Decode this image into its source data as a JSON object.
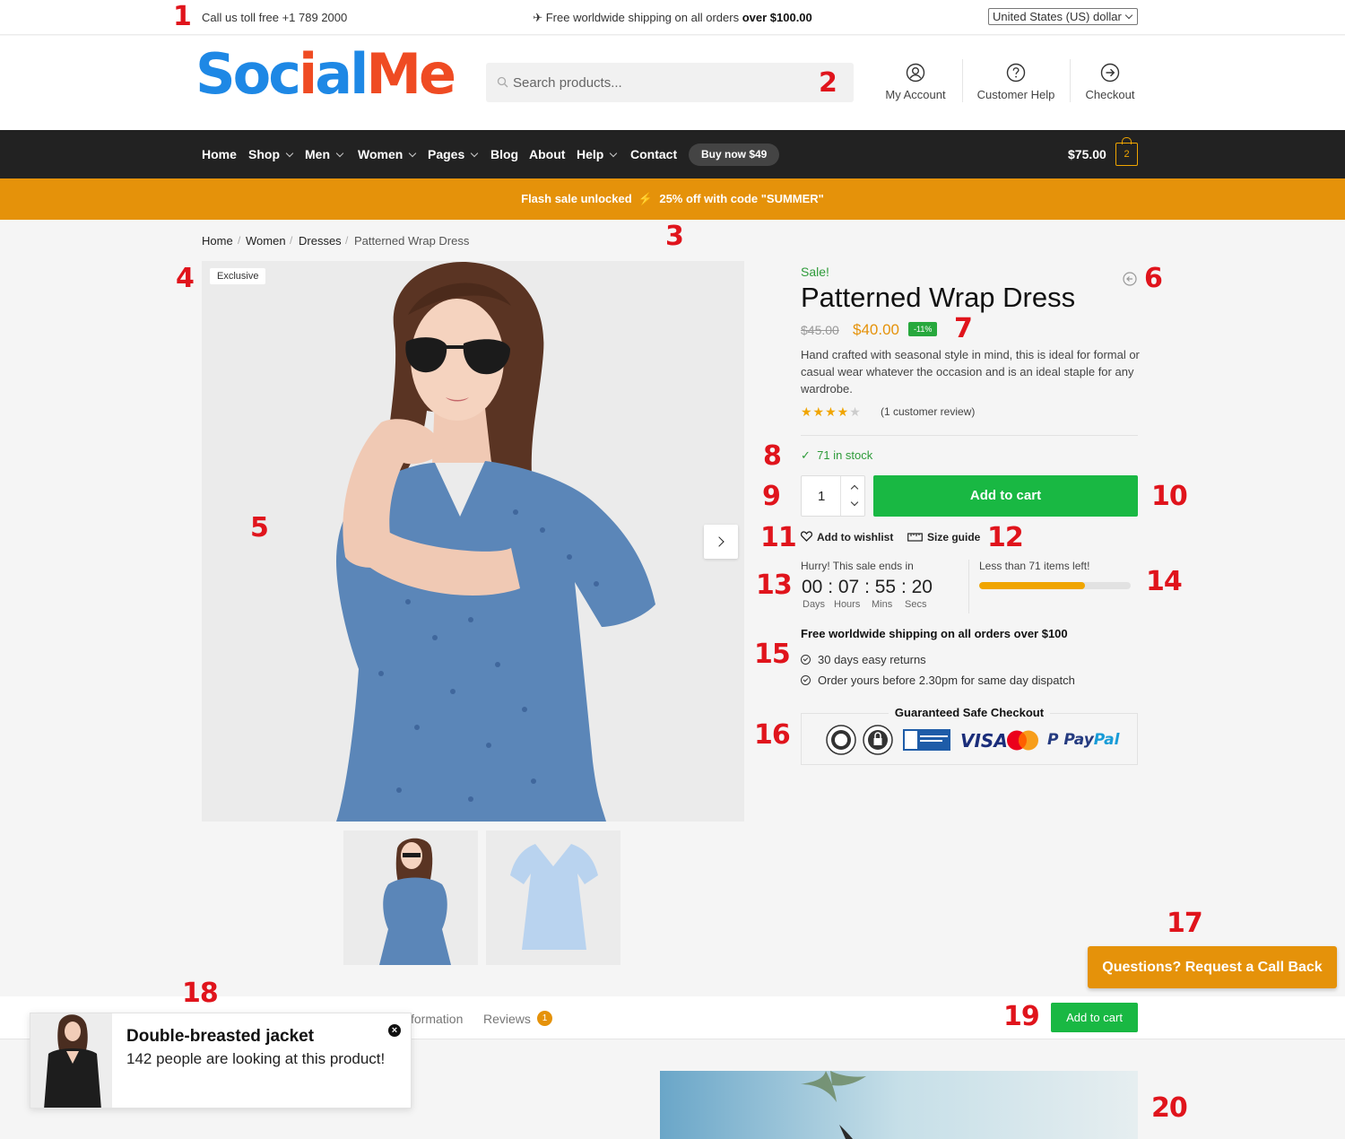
{
  "annotations": [
    "1",
    "2",
    "3",
    "4",
    "5",
    "6",
    "7",
    "8",
    "9",
    "10",
    "11",
    "12",
    "13",
    "14",
    "15",
    "16",
    "17",
    "18",
    "19",
    "20"
  ],
  "topbar": {
    "call": "Call us toll free +1 789 2000",
    "shipping_prefix": "Free worldwide shipping on all orders",
    "shipping_bold": "over $100.00",
    "currency": "United States (US) dollar"
  },
  "header": {
    "logo_part1": "Soc",
    "logo_part2": "i",
    "logo_part3": "al",
    "logo_part4": "Me",
    "search_placeholder": "Search products...",
    "links": {
      "account": "My Account",
      "help": "Customer Help",
      "checkout": "Checkout"
    }
  },
  "nav": {
    "items": [
      "Home",
      "Shop",
      "Men",
      "Women",
      "Pages",
      "Blog",
      "About",
      "Help",
      "Contact"
    ],
    "buy_now": "Buy now $49",
    "cart_total": "$75.00",
    "cart_count": "2"
  },
  "flash": {
    "text": "Flash sale unlocked",
    "code_text": "25% off with code \"SUMMER\""
  },
  "breadcrumb": [
    "Home",
    "Women",
    "Dresses",
    "Patterned Wrap Dress"
  ],
  "gallery": {
    "badge": "Exclusive"
  },
  "product": {
    "sale": "Sale!",
    "title": "Patterned Wrap Dress",
    "old_price": "$45.00",
    "price": "$40.00",
    "discount": "-11%",
    "description": "Hand crafted with seasonal style in mind, this is ideal for formal or casual wear whatever the occasion and is an ideal staple for any wardrobe.",
    "rating": 4,
    "reviews": "(1 customer review)",
    "stock": "71 in stock",
    "quantity": "1",
    "add_to_cart": "Add to cart",
    "wishlist": "Add to wishlist",
    "size_guide": "Size guide",
    "hurry": "Hurry! This sale ends in",
    "timer": {
      "days": "00",
      "hours": "07",
      "mins": "55",
      "secs": "20"
    },
    "timer_labels": {
      "days": "Days",
      "hours": "Hours",
      "mins": "Mins",
      "secs": "Secs"
    },
    "less_than": "Less than 71 items left!",
    "stock_progress": 0.7,
    "free_shipping": "Free worldwide shipping on all orders over $100",
    "returns": "30 days easy returns",
    "dispatch": "Order yours before 2.30pm for same day dispatch",
    "safe_checkout": "Guaranteed Safe Checkout",
    "payment": {
      "visa": "VISA",
      "paypal_a": "Pay",
      "paypal_b": "Pal"
    }
  },
  "callback": "Questions? Request a Call Back",
  "sticky": {
    "tab_info": "formation",
    "tab_reviews": "Reviews",
    "reviews_count": "1",
    "add_to_cart": "Add to cart"
  },
  "popup": {
    "title": "Double-breasted jacket",
    "subtitle": "142 people are looking at this product!",
    "close": "×"
  },
  "colors": {
    "green": "#19b843",
    "orange": "#e5920a",
    "dark": "#222222",
    "red": "#e0141c"
  }
}
